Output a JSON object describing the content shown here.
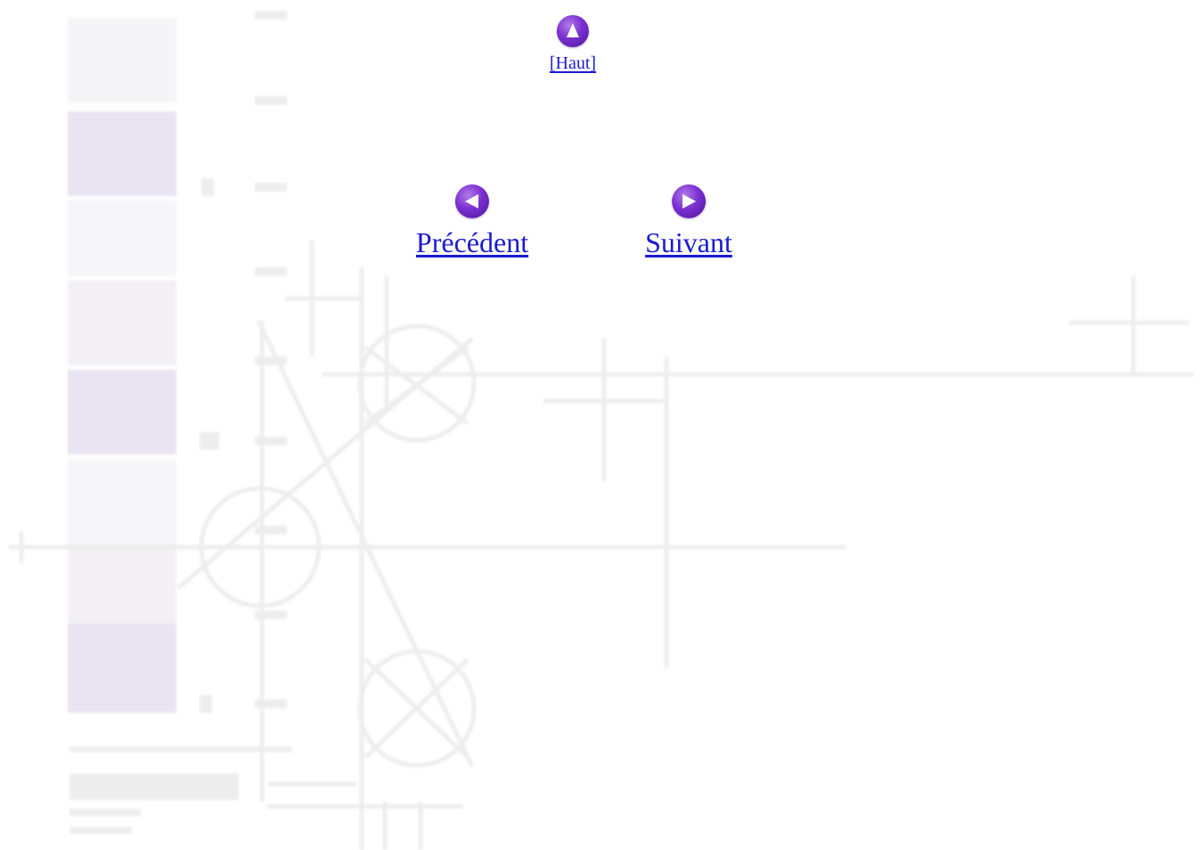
{
  "navigation": {
    "top": {
      "label": "[Haut]",
      "icon": "up-arrow-icon"
    },
    "previous": {
      "label": "Précédent",
      "icon": "left-arrow-icon"
    },
    "next": {
      "label": "Suivant",
      "icon": "right-arrow-icon"
    }
  },
  "colors": {
    "link": "#1a1ad0",
    "icon": "#7a2fd0",
    "watermark_stripe": "#e6dff2",
    "watermark_line": "#ececec"
  }
}
